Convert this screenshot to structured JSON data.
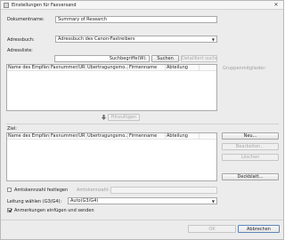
{
  "window": {
    "title": "Einstellungen für Faxversand",
    "close_glyph": "✕"
  },
  "document_name": {
    "label": "Dokumentname:",
    "value": "Summary of Research"
  },
  "address_book": {
    "label": "Adressbuch:",
    "value": "Adressbuch des Canon-Faxtreibers"
  },
  "address_list": {
    "label": "Adressliste:",
    "search_placeholder": "Suchbegriffe(W):",
    "search_button": "Suchen",
    "detail_search_button": "Detailliert suchen",
    "columns": [
      "Name des Empfän...",
      "Faxnummer/URI",
      "Übertragungsmo...",
      "Firmenname",
      "Abteilung"
    ]
  },
  "group_members": {
    "label": "Gruppenmitglieder:"
  },
  "add_button": "Hinzufügen",
  "destination": {
    "label": "Ziel:",
    "columns": [
      "Name des Empfän...",
      "Faxnummer/URI",
      "Übertragungsmo...",
      "Firmenname",
      "Abteilung"
    ]
  },
  "side_buttons": {
    "new": "Neu...",
    "edit": "Bearbeiten...",
    "delete": "Löschen",
    "cover": "Deckblatt..."
  },
  "outside_line": {
    "checkbox_label": "Amtskennzahl festlegen",
    "number_label": "Amtskennzahl:"
  },
  "line_select": {
    "label": "Leitung wählen (G3/G4):",
    "value": "Auto(G3/G4)"
  },
  "annotations": {
    "label": "Anmerkungen einfügen und senden",
    "checked": true
  },
  "footer": {
    "ok": "OK",
    "cancel": "Abbrechen"
  }
}
